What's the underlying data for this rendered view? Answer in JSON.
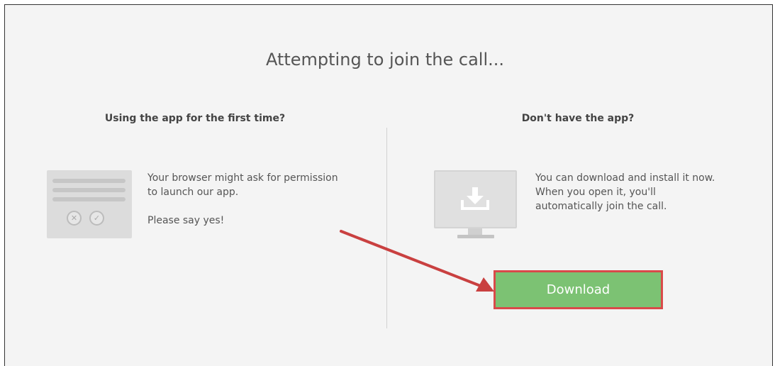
{
  "page": {
    "title": "Attempting to join the call..."
  },
  "left_column": {
    "heading": "Using the app for the first time?",
    "paragraph1": "Your browser might ask for permission to launch our app.",
    "paragraph2": "Please say yes!",
    "icons": {
      "deny": "x-circle-icon",
      "approve": "check-circle-icon"
    }
  },
  "right_column": {
    "heading": "Don't have the app?",
    "paragraph": "You can download and install it now. When you open it, you'll automatically join the call.",
    "icon": "monitor-download-icon",
    "button_label": "Download"
  },
  "annotation": {
    "arrow_color": "#d94a4a",
    "highlight_color": "#d94a4a"
  },
  "colors": {
    "button_green": "#7cc273",
    "background": "#f4f4f4"
  }
}
